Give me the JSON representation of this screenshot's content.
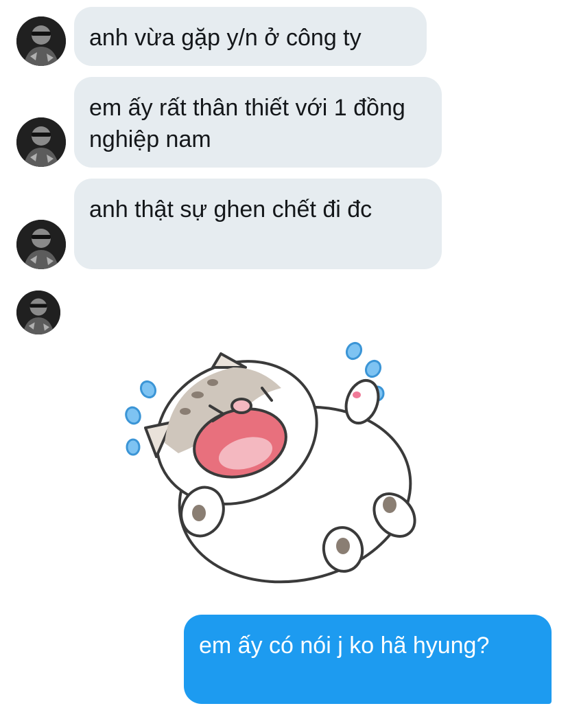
{
  "conversation": {
    "messages": [
      {
        "sender": "other",
        "text": "anh vừa gặp y/n ở công ty"
      },
      {
        "sender": "other",
        "text": "em ấy rất thân thiết với 1 đồng nghiệp nam"
      },
      {
        "sender": "other",
        "text": "anh thật sự ghen chết đi đc"
      },
      {
        "sender": "other",
        "type": "sticker",
        "sticker_name": "crying-cat-sticker"
      },
      {
        "sender": "me",
        "text": "em ấy có nói j ko hã hyung?"
      }
    ]
  },
  "colors": {
    "incoming_bubble": "#e6ecf0",
    "outgoing_bubble": "#1d9bf0",
    "incoming_text": "#14171a",
    "outgoing_text": "#ffffff"
  },
  "icons": {
    "avatar": "contact-avatar",
    "sticker": "crying-cat-sticker"
  }
}
